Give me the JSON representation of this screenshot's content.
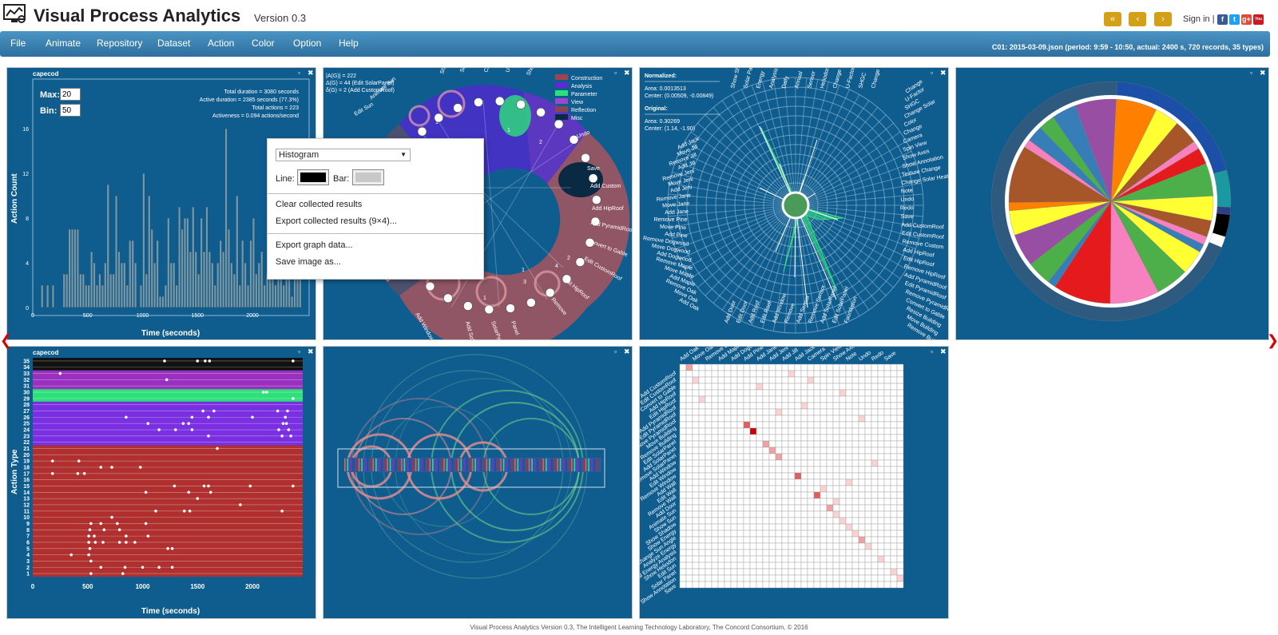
{
  "header": {
    "title": "Visual Process Analytics",
    "version": "Version 0.3",
    "nav_first": "«",
    "nav_prev": "‹",
    "nav_next": "›",
    "signin": "Sign in |",
    "social": {
      "facebook": "f",
      "twitter": "t",
      "google": "g+",
      "youtube": "You"
    }
  },
  "menu": {
    "items": [
      "File",
      "Animate",
      "Repository",
      "Dataset",
      "Action",
      "Color",
      "Option",
      "Help"
    ],
    "status": "C01: 2015-03-09.json (period: 9:59 - 10:50, actual: 2400 s, 720 records, 35 types)"
  },
  "histogram": {
    "title": "capecod",
    "max_label": "Max:",
    "max_value": "20",
    "bin_label": "Bin:",
    "bin_value": "50",
    "stats": [
      "Total duration = 3080 seconds",
      "Active duration = 2385 seconds (77.3%)",
      "Total actions = 223",
      "Activeness = 0.094 actions/second"
    ],
    "ylabel": "Action Count",
    "xlabel": "Time (seconds)"
  },
  "graph_panel": {
    "stats": [
      "|A(G)| = 222",
      "Δ(G) = 44 (Edit SolarPanel)",
      "δ(G) = 2 (Add CustomRoof)"
    ],
    "legend": [
      {
        "label": "Construction",
        "color": "#a0444f"
      },
      {
        "label": "Analysis",
        "color": "#5a2bd6"
      },
      {
        "label": "Parameter",
        "color": "#2ee07a"
      },
      {
        "label": "View",
        "color": "#9a49cf"
      },
      {
        "label": "Reflection",
        "color": "#8a4550"
      },
      {
        "label": "Misc",
        "color": "#0a2a44"
      }
    ],
    "labels": [
      "Show Shadow",
      "Solar",
      "Change",
      "U-Factor",
      "Show Annotation",
      "Undo",
      "Save",
      "Add Custom",
      "Add HipRoof",
      "Add PyramidRoof",
      "Convert to Gable",
      "Edit CustomRoof",
      "Edit HipRoof",
      "Remove",
      "Panel",
      "SolarPanel",
      "Add SolarPanel",
      "Add Window",
      "Edit Window",
      "Add Oak",
      "Edit Sun",
      "Animate Sun"
    ],
    "nums": [
      "1",
      "2",
      "4",
      "2",
      "2",
      "1",
      "2",
      "1",
      "1",
      "3",
      "4",
      "1",
      "1"
    ]
  },
  "radial_panel": {
    "normalized": "Normalized:",
    "area_n": "Area: 0.0013513",
    "center_n": "Center: (0.00509, -0.00849)",
    "original": "Original:",
    "area_o": "Area: 0.30269",
    "center_o": "Center: (1.14, -1.90)",
    "left_labels": [
      "Add Jack",
      "Move Jill",
      "Remove Jill",
      "Add Jill",
      "Remove Jeni",
      "Move Jeni",
      "Add Jeni",
      "Remove Jane",
      "Move Jane",
      "Add Jane",
      "Remove Pine",
      "Move Pine",
      "Add Pine",
      "Remove Dogwood",
      "Move Dogwood",
      "Add Dogwood",
      "Remove Maple",
      "Move Maple",
      "Add Maple",
      "Remove Oak",
      "Move Oak",
      "Add Oak"
    ],
    "right_labels": [
      "Change",
      "U-Factor",
      "SHGC",
      "Change Solar",
      "Color",
      "Change",
      "Camera",
      "Spin View",
      "Show Axes",
      "Show Annotation",
      "Texture Change",
      "Change Solar Heat",
      "Note",
      "Undo",
      "Redo",
      "Save",
      "Add CustomRoof",
      "Edit CustomRoof",
      "Remove Custom",
      "Add HipRoof",
      "Edit HipRoof",
      "Remove HipRoof",
      "Add PyramidRoof",
      "Edit PyramidRoof",
      "Remove PyramidRoof",
      "Convert to Gable",
      "Resize Building",
      "Move Building",
      "Remove Building"
    ],
    "top_labels": [
      "Show Shadow",
      "Solar Panel",
      "Energy",
      "Analysis",
      "Daily",
      "Annual",
      "Sensor",
      "Heliodon",
      "Change",
      "U-Factor",
      "SHGC",
      "Change"
    ],
    "bottom_labels": [
      "Add Door",
      "Edit Door",
      "Add Roof",
      "Edit Roof",
      "Add Window",
      "Remove",
      "Add Sensor",
      "Remove Sensor",
      "Add SolarPanel",
      "Edit SolarPanel",
      "Foundation"
    ]
  },
  "pie_panel": {},
  "timeline": {
    "title": "capecod",
    "ylabel": "Action Type",
    "xlabel": "Time (seconds)"
  },
  "matrix_panel": {
    "top_labels": [
      "Add Oak",
      "Move Oak",
      "Remove Oak",
      "Add Maple",
      "Add Dogwood",
      "Add Pine",
      "Add Jane",
      "Add Jeni",
      "Add Jill",
      "Add Jack",
      "Camera",
      "Spin View",
      "Show Axes",
      "Note",
      "Undo",
      "Redo",
      "Save"
    ],
    "left_labels": [
      "Add CustomRoof",
      "Edit CustomRoof",
      "Convert to Gable",
      "Add HipRoof",
      "Edit HipRoof",
      "Add PyramidRoof",
      "Edit PyramidRoof",
      "Remove PyramidRoof",
      "Move Building",
      "Remove Building",
      "Edit SolarPanel",
      "Add SolarPanel",
      "Remove SolarPanel",
      "Add Window",
      "Edit Window",
      "Remove Window",
      "Add Wall",
      "Edit Wall",
      "Remove Wall",
      "Add Door",
      "Animate Sun",
      "Show Sun",
      "Show Shadow",
      "Show Energy",
      "Change Sun Angle",
      "Analyze Energy",
      "Annual Energy Analysis",
      "Show Heliodon",
      "Edit Sun",
      "Solar Panel",
      "Show Annotation",
      "Save"
    ]
  },
  "context_menu": {
    "select_value": "Histogram",
    "line_label": "Line:",
    "bar_label": "Bar:",
    "clear": "Clear collected results",
    "export_results": "Export collected results (9×4)...",
    "export_graph": "Export graph data...",
    "save_image": "Save image as..."
  },
  "footer": "Visual Process Analytics Version 0.3, The Intelligent Learning Technology Laboratory, The Concord Consortium, © 2016",
  "chart_data": [
    {
      "type": "bar",
      "title": "",
      "xlabel": "Time (seconds)",
      "ylabel": "Action Count",
      "xlim": [
        0,
        2400
      ],
      "ylim": [
        0,
        20
      ],
      "xticks": [
        "0",
        "500",
        "1000",
        "1500",
        "2000"
      ],
      "yticks": [
        "0",
        "4",
        "8",
        "12",
        "16"
      ],
      "bin_width": 50,
      "values": [
        0,
        0,
        0,
        2,
        0,
        2,
        0,
        2,
        0,
        0,
        0,
        3,
        3,
        7,
        7,
        7,
        7,
        3,
        3,
        2,
        2,
        5,
        4,
        2,
        3,
        2,
        4,
        11,
        3,
        3,
        10,
        5,
        4,
        4,
        2,
        6,
        6,
        4,
        0,
        2,
        12,
        3,
        10,
        7,
        4,
        6,
        1,
        1,
        2,
        8,
        4,
        4,
        2,
        9,
        7,
        8,
        8,
        5,
        9,
        5,
        3,
        8,
        5,
        9,
        5,
        4,
        2,
        4,
        6,
        5,
        16,
        7,
        4,
        3,
        10,
        2,
        6,
        4,
        2,
        6,
        8,
        3,
        4,
        5,
        2,
        3,
        9,
        4,
        2,
        8,
        5,
        2,
        3,
        4,
        1,
        3,
        4,
        6
      ]
    },
    {
      "type": "scatter",
      "title": "",
      "xlabel": "Time (seconds)",
      "ylabel": "Action Type",
      "xlim": [
        0,
        2400
      ],
      "ylim": [
        0,
        35
      ],
      "xticks": [
        "0",
        "500",
        "1000",
        "1500",
        "2000"
      ],
      "yticks": [
        "1",
        "2",
        "3",
        "4",
        "5",
        "6",
        "7",
        "8",
        "9",
        "10",
        "11",
        "12",
        "13",
        "14",
        "15",
        "16",
        "17",
        "18",
        "19",
        "20",
        "21",
        "22",
        "23",
        "24",
        "25",
        "26",
        "27",
        "28",
        "29",
        "30",
        "31",
        "32",
        "33",
        "34",
        "35"
      ],
      "bands": [
        {
          "from": 1,
          "to": 21,
          "color": "#b03030"
        },
        {
          "from": 22,
          "to": 28,
          "color": "#7a2fe0"
        },
        {
          "from": 29,
          "to": 30,
          "color": "#2ee07a"
        },
        {
          "from": 31,
          "to": 33,
          "color": "#9a30c0"
        },
        {
          "from": 34,
          "to": 35,
          "color": "#111111"
        }
      ],
      "points": [
        [
          1200,
          35
        ],
        [
          1500,
          35
        ],
        [
          1570,
          35
        ],
        [
          1610,
          35
        ],
        [
          2370,
          35
        ],
        [
          250,
          33
        ],
        [
          1220,
          32
        ],
        [
          2100,
          30
        ],
        [
          2130,
          30
        ],
        [
          2370,
          29
        ],
        [
          1550,
          27
        ],
        [
          1650,
          27
        ],
        [
          2230,
          27
        ],
        [
          2320,
          27
        ],
        [
          850,
          26
        ],
        [
          1450,
          26
        ],
        [
          1600,
          26
        ],
        [
          2000,
          26
        ],
        [
          2300,
          26
        ],
        [
          1050,
          25
        ],
        [
          1370,
          25
        ],
        [
          1420,
          25
        ],
        [
          2280,
          25
        ],
        [
          2310,
          25
        ],
        [
          1150,
          24
        ],
        [
          1300,
          24
        ],
        [
          1450,
          24
        ],
        [
          2240,
          24
        ],
        [
          2330,
          24
        ],
        [
          1600,
          23
        ],
        [
          2270,
          23
        ],
        [
          2350,
          23
        ],
        [
          1680,
          21
        ],
        [
          180,
          19
        ],
        [
          420,
          19
        ],
        [
          620,
          18
        ],
        [
          720,
          18
        ],
        [
          980,
          18
        ],
        [
          180,
          17
        ],
        [
          410,
          17
        ],
        [
          470,
          17
        ],
        [
          1290,
          15
        ],
        [
          1560,
          15
        ],
        [
          1600,
          15
        ],
        [
          1980,
          15
        ],
        [
          2370,
          15
        ],
        [
          1030,
          14
        ],
        [
          1420,
          14
        ],
        [
          1620,
          14
        ],
        [
          1500,
          13
        ],
        [
          1890,
          12
        ],
        [
          1120,
          11
        ],
        [
          1380,
          11
        ],
        [
          1430,
          11
        ],
        [
          2270,
          11
        ],
        [
          720,
          10
        ],
        [
          530,
          9
        ],
        [
          620,
          9
        ],
        [
          770,
          9
        ],
        [
          1030,
          9
        ],
        [
          520,
          8
        ],
        [
          650,
          8
        ],
        [
          790,
          8
        ],
        [
          510,
          7
        ],
        [
          560,
          7
        ],
        [
          850,
          7
        ],
        [
          1050,
          7
        ],
        [
          510,
          6
        ],
        [
          570,
          6
        ],
        [
          640,
          6
        ],
        [
          790,
          6
        ],
        [
          850,
          6
        ],
        [
          930,
          6
        ],
        [
          520,
          5
        ],
        [
          1230,
          5
        ],
        [
          1270,
          5
        ],
        [
          350,
          4
        ],
        [
          510,
          4
        ],
        [
          530,
          3
        ],
        [
          620,
          2
        ],
        [
          840,
          2
        ],
        [
          1000,
          2
        ],
        [
          1150,
          2
        ],
        [
          1270,
          2
        ],
        [
          530,
          1
        ],
        [
          820,
          1
        ]
      ]
    },
    {
      "type": "pie",
      "title": "",
      "slices": [
        {
          "color": "#ff8000",
          "value": 5
        },
        {
          "color": "#ffff33",
          "value": 3
        },
        {
          "color": "#a65628",
          "value": 3
        },
        {
          "color": "#f781bf",
          "value": 1
        },
        {
          "color": "#e41a1c",
          "value": 2
        },
        {
          "color": "#4daf4a",
          "value": 4
        },
        {
          "color": "#ffff33",
          "value": 3
        },
        {
          "color": "#a65628",
          "value": 2
        },
        {
          "color": "#f781bf",
          "value": 1
        },
        {
          "color": "#377eb8",
          "value": 1
        },
        {
          "color": "#ffff33",
          "value": 3
        },
        {
          "color": "#4daf4a",
          "value": 4
        },
        {
          "color": "#f781bf",
          "value": 6
        },
        {
          "color": "#e41a1c",
          "value": 7
        },
        {
          "color": "#377eb8",
          "value": 1
        },
        {
          "color": "#4daf4a",
          "value": 3
        },
        {
          "color": "#984ea3",
          "value": 4
        },
        {
          "color": "#ffff33",
          "value": 3
        },
        {
          "color": "#ff8000",
          "value": 1
        },
        {
          "color": "#a65628",
          "value": 7
        },
        {
          "color": "#f781bf",
          "value": 1
        },
        {
          "color": "#377eb8",
          "value": 2
        },
        {
          "color": "#4daf4a",
          "value": 2
        },
        {
          "color": "#377eb8",
          "value": 3
        },
        {
          "color": "#984ea3",
          "value": 5
        }
      ],
      "outer_ring": [
        {
          "color": "#1c4fa8",
          "value": 40
        },
        {
          "color": "#1a9aa0",
          "value": 10
        },
        {
          "color": "#2b3f86",
          "value": 2
        },
        {
          "color": "#000000",
          "value": 6
        },
        {
          "color": "#ffffff",
          "value": 3
        },
        {
          "color": "#2e5a80",
          "value": 139
        }
      ]
    },
    {
      "type": "heatmap",
      "title": "",
      "size": 35,
      "cells": [
        [
          0,
          1,
          3
        ],
        [
          2,
          2,
          2
        ],
        [
          5,
          3,
          2
        ],
        [
          9,
          10,
          5
        ],
        [
          10,
          11,
          9
        ],
        [
          12,
          13,
          3
        ],
        [
          13,
          14,
          3
        ],
        [
          14,
          15,
          4
        ],
        [
          17,
          18,
          6
        ],
        [
          20,
          21,
          5
        ],
        [
          22,
          23,
          3
        ],
        [
          23,
          24,
          2
        ],
        [
          24,
          25,
          2
        ],
        [
          25,
          26,
          2
        ],
        [
          27,
          28,
          4
        ],
        [
          30,
          31,
          2
        ],
        [
          32,
          33,
          2
        ],
        [
          1,
          17,
          1
        ],
        [
          2,
          20,
          1
        ],
        [
          4,
          25,
          1
        ],
        [
          6,
          19,
          1
        ],
        [
          8,
          28,
          1
        ],
        [
          15,
          30,
          1
        ],
        [
          18,
          26,
          1
        ],
        [
          3,
          12,
          1
        ],
        [
          7,
          15,
          1
        ],
        [
          19,
          22,
          2
        ],
        [
          21,
          24,
          1
        ],
        [
          26,
          27,
          1
        ],
        [
          28,
          29,
          1
        ],
        [
          33,
          34,
          1
        ]
      ]
    }
  ]
}
